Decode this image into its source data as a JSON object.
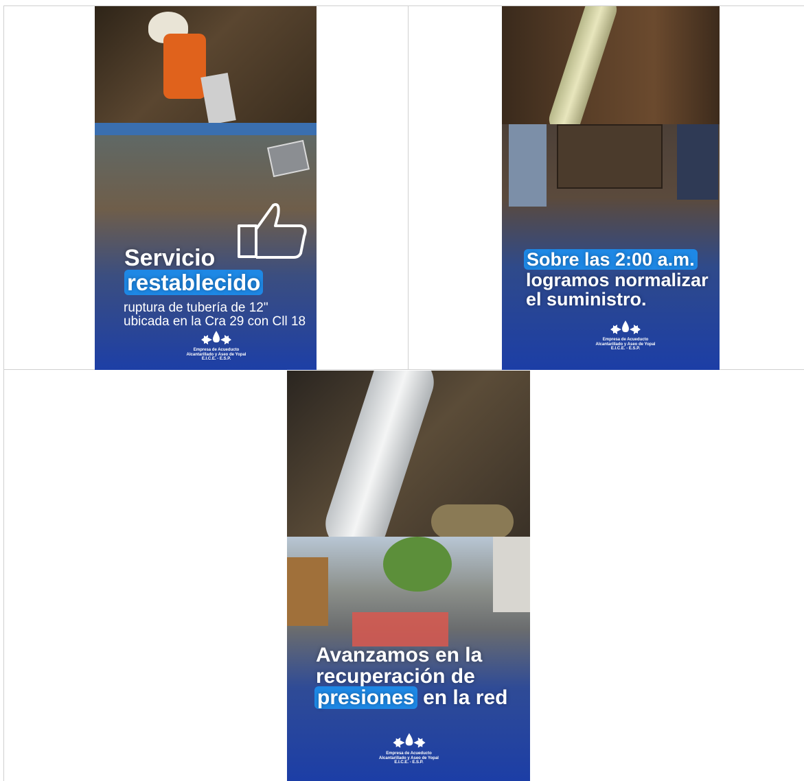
{
  "posters": [
    {
      "headline_line1": "Servicio",
      "headline_highlight": "restablecido",
      "sub_line1": "ruptura de tubería  de 12\"",
      "sub_line2": "ubicada en la Cra 29 con Cll 18",
      "logo_line1": "Empresa de Acueducto",
      "logo_line2": "Alcantarillado y Aseo de Yopal",
      "logo_line3": "E.I.C.E. - E.S.P."
    },
    {
      "headline_highlight": "Sobre las 2:00 a.m.",
      "headline_line2": "logramos normalizar",
      "headline_line3": "el suministro.",
      "logo_line1": "Empresa de Acueducto",
      "logo_line2": "Alcantarillado y Aseo de Yopal",
      "logo_line3": "E.I.C.E. - E.S.P."
    },
    {
      "headline_line1": "Avanzamos en la",
      "headline_line2": "recuperación de",
      "headline_highlight": "presiones",
      "headline_tail": "en la red",
      "logo_line1": "Empresa de Acueducto",
      "logo_line2": "Alcantarillado y Aseo de Yopal",
      "logo_line3": "E.I.C.E. - E.S.P."
    }
  ],
  "colors": {
    "brand_blue": "#1a3fa8",
    "highlight": "#1e88e5",
    "soil": "#4a3a2a"
  }
}
